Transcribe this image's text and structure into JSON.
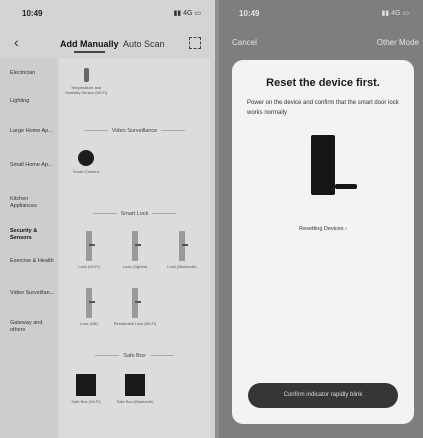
{
  "left_screen": {
    "status": {
      "time": "10:49",
      "signal": "▮▮ 4G ▭"
    },
    "tabs": [
      "Add Manually",
      "Auto Scan"
    ],
    "sidebar": [
      "Electrician",
      "Lighting",
      "Large Home Ap...",
      "Small Home Ap...",
      "Kitchen Appliances",
      "Security & Sensors",
      "Exercise & Health",
      "Video Surveillan...",
      "Gateway and others"
    ],
    "active_category": "Security & Sensors",
    "content": {
      "top_item": "Temperature and Humidity Sensor (Wi-Fi)",
      "sections": {
        "video": "Video Surveillance",
        "lock": "Smart Lock",
        "safe": "Safe Box"
      },
      "video_item": "Smart Camera",
      "locks": [
        "Lock (Wi-Fi)",
        "Lock (Zigbee)",
        "Lock (Bluetooth)",
        "Lock (NB)",
        "Residential Lock (Wi-Fi)"
      ],
      "safes": [
        "Safe Box (Wi-Fi)",
        "Safe Box (Bluetooth)"
      ]
    }
  },
  "right_screen": {
    "status": {
      "time": "10:49",
      "signal": "▮▮ 4G ▭"
    },
    "nav": {
      "cancel": "Cancel",
      "other": "Other Mode"
    },
    "title": "Reset the device first.",
    "description": "Power on the device and confirm that the smart door lock works normally",
    "resetting_link": "Resetting Devices ›",
    "confirm_button": "Confirm indicator rapidly blink"
  }
}
